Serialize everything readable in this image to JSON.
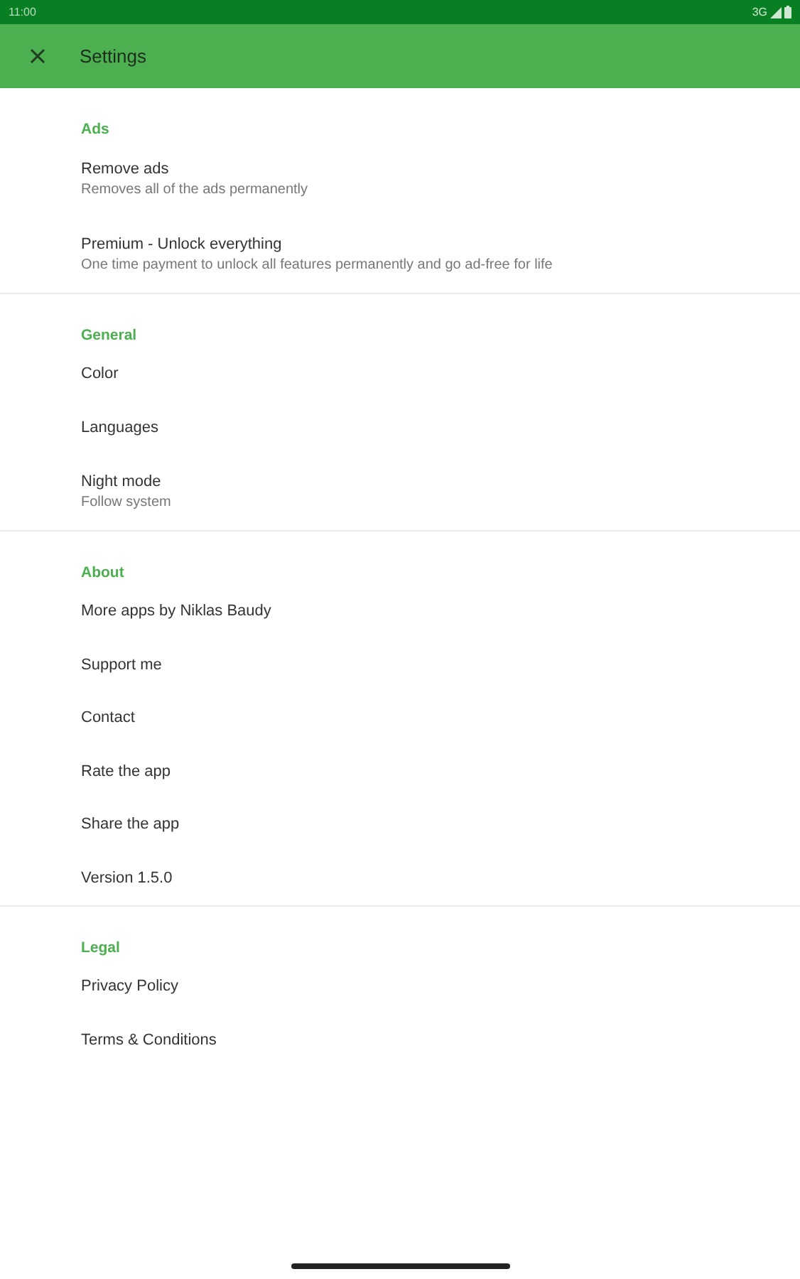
{
  "status_bar": {
    "time": "11:00",
    "network": "3G"
  },
  "app_bar": {
    "title": "Settings"
  },
  "sections": [
    {
      "header": "Ads",
      "items": [
        {
          "title": "Remove ads",
          "summary": "Removes all of the ads permanently"
        },
        {
          "title": "Premium - Unlock everything",
          "summary": "One time payment to unlock all features permanently and go ad-free for life"
        }
      ]
    },
    {
      "header": "General",
      "items": [
        {
          "title": "Color"
        },
        {
          "title": "Languages"
        },
        {
          "title": "Night mode",
          "summary": "Follow system"
        }
      ]
    },
    {
      "header": "About",
      "items": [
        {
          "title": "More apps by Niklas Baudy"
        },
        {
          "title": "Support me"
        },
        {
          "title": "Contact"
        },
        {
          "title": "Rate the app"
        },
        {
          "title": "Share the app"
        },
        {
          "title": "Version 1.5.0"
        }
      ]
    },
    {
      "header": "Legal",
      "items": [
        {
          "title": "Privacy Policy"
        },
        {
          "title": "Terms & Conditions"
        }
      ]
    }
  ]
}
